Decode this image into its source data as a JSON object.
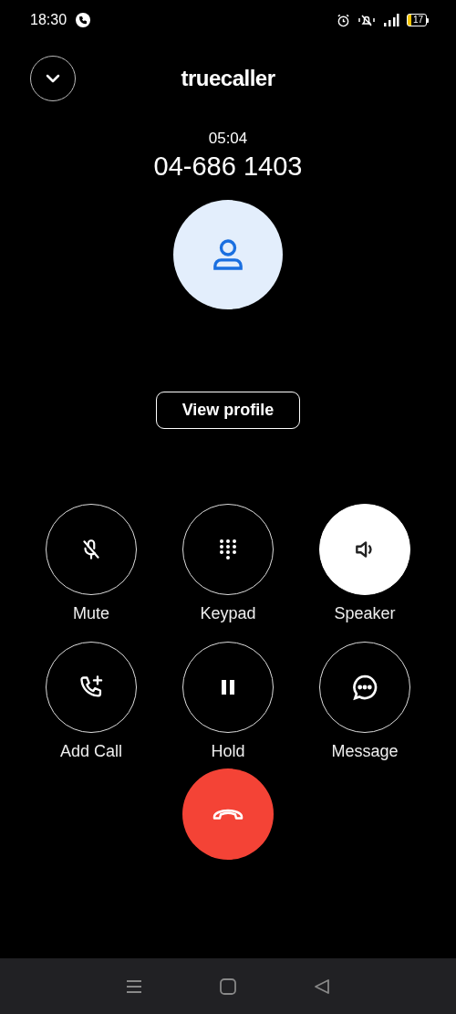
{
  "status_bar": {
    "time": "18:30",
    "battery": "17"
  },
  "header": {
    "logo": "truecaller"
  },
  "call": {
    "duration": "05:04",
    "number": "04-686 1403"
  },
  "view_profile": "View profile",
  "controls": [
    {
      "kind": "mute",
      "label": "Mute",
      "on": false
    },
    {
      "kind": "keypad",
      "label": "Keypad",
      "on": false
    },
    {
      "kind": "speaker",
      "label": "Speaker",
      "on": true
    },
    {
      "kind": "add_call",
      "label": "Add Call",
      "on": false
    },
    {
      "kind": "hold",
      "label": "Hold",
      "on": false
    },
    {
      "kind": "message",
      "label": "Message",
      "on": false
    }
  ]
}
